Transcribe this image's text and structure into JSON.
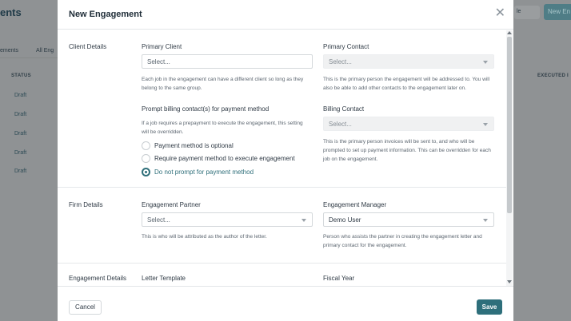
{
  "background": {
    "title": "ents",
    "tabs": [
      "ements",
      "All Eng"
    ],
    "status_header": "STATUS",
    "draft_rows": [
      "Draft",
      "Draft",
      "Draft",
      "Draft",
      "Draft"
    ],
    "right_button_1": "le",
    "right_button_2": "New En",
    "executed_header": "EXECUTED I"
  },
  "modal": {
    "title": "New Engagement",
    "close_glyph": "✕",
    "sections": {
      "client_details": "Client Details",
      "firm_details": "Firm Details",
      "engagement_details": "Engagement Details"
    },
    "client": {
      "primary_client_label": "Primary Client",
      "primary_client_placeholder": "Select...",
      "primary_client_help": "Each job in the engagement can have a different client so long as they belong to the same group.",
      "primary_contact_label": "Primary Contact",
      "primary_contact_placeholder": "Select...",
      "primary_contact_help": "This is the primary person the engagement will be addressed to. You will also be able to add other contacts to the engagement later on.",
      "prompt_label": "Prompt billing contact(s) for payment method",
      "prompt_help": "If a job requires a prepayment to execute the engagement, this setting will be overridden.",
      "radio_options": [
        {
          "label": "Payment method is optional",
          "checked": false
        },
        {
          "label": "Require payment method to execute engagement",
          "checked": false
        },
        {
          "label": "Do not prompt for payment method",
          "checked": true
        }
      ],
      "billing_contact_label": "Billing Contact",
      "billing_contact_placeholder": "Select...",
      "billing_contact_help": "This is the primary person invoices will be sent to, and who will be prompted to set up payment information. This can be overridden for each job on the engagement."
    },
    "firm": {
      "partner_label": "Engagement Partner",
      "partner_placeholder": "Select...",
      "partner_help": "This is who will be attributed as the author of the letter.",
      "manager_label": "Engagement Manager",
      "manager_value": "Demo User",
      "manager_help": "Person who assists the partner in creating the engagement letter and primary contact for the engagement."
    },
    "engagement": {
      "letter_template_label": "Letter Template",
      "fiscal_year_label": "Fiscal Year"
    },
    "footer": {
      "cancel_label": "Cancel",
      "save_label": "Save"
    }
  },
  "colors": {
    "accent": "#2e6f7b",
    "overlay": "#8f9294"
  }
}
